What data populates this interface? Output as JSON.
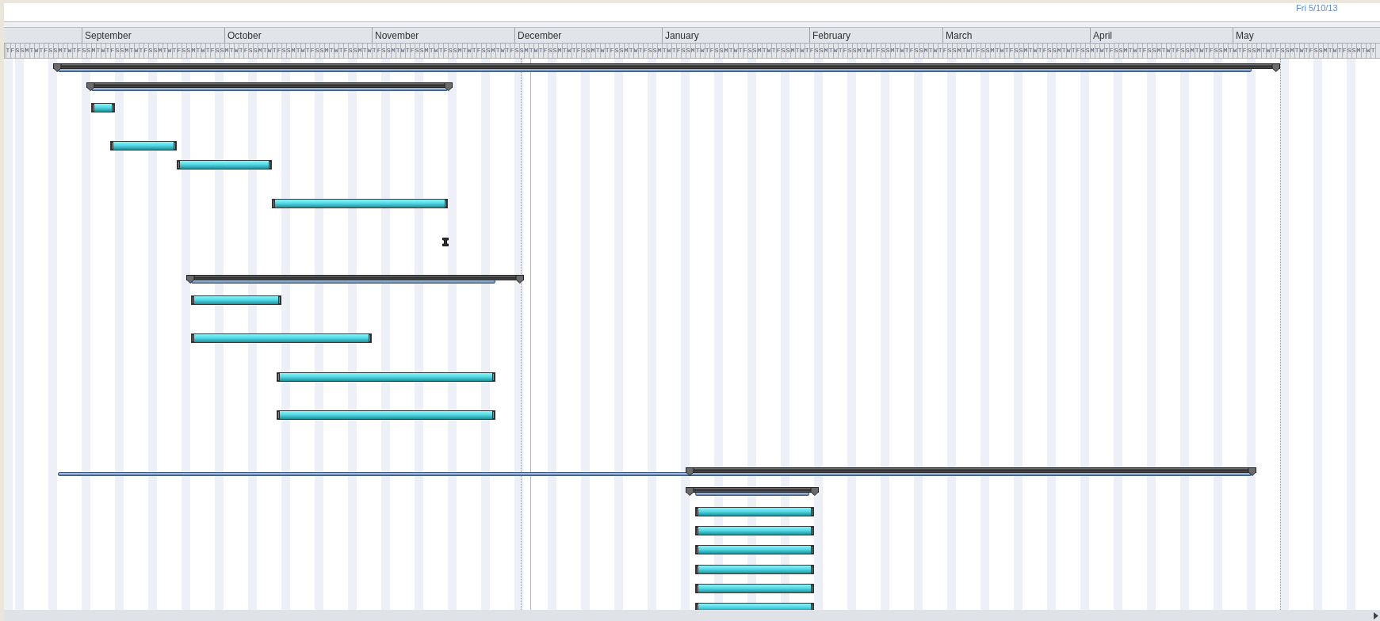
{
  "timescale": {
    "months": [
      "September",
      "October",
      "November",
      "December",
      "January",
      "February",
      "March",
      "April",
      "May"
    ],
    "day_letters": "TFSSMTWTFSSMTWTFSSMTWTFSSMTWTFSSMTWTFSSMTWTFSSMTWTFSSMTWTFSSMTWTFSSMTWTFSSMTWTFSSMTWTFSSMTWTFSSMTWTFSSMTWTFSSMTWTFSSMTWTFSSMTWTFSSMTWTFSSMTWTFSSMTWTFSSMTWTFSSMTWTFSSMTWTFSSMTWTFSSMTWTFSSMTWTFSSMTWTFSSMTWTFSSMTWTFSSMTWTFSSMTWTFSSMTWTFSSMTWTFSSMTWTFSSMTWTFSSMTWTFSSMTWTFSSMTWTFSSMTWTFSSMTWT"
  },
  "markers": [
    {
      "kind": "status"
    },
    {
      "kind": "today"
    },
    {
      "kind": "finish",
      "label": "Fri 5/10/13"
    }
  ],
  "rows": [
    {
      "kind": "summary"
    },
    {
      "kind": "summary"
    },
    {
      "kind": "task"
    },
    {
      "kind": "blank"
    },
    {
      "kind": "task"
    },
    {
      "kind": "task"
    },
    {
      "kind": "blank"
    },
    {
      "kind": "task"
    },
    {
      "kind": "blank"
    },
    {
      "kind": "milestone"
    },
    {
      "kind": "blank"
    },
    {
      "kind": "summary"
    },
    {
      "kind": "task"
    },
    {
      "kind": "blank"
    },
    {
      "kind": "task"
    },
    {
      "kind": "blank"
    },
    {
      "kind": "task"
    },
    {
      "kind": "blank"
    },
    {
      "kind": "task"
    },
    {
      "kind": "blank"
    },
    {
      "kind": "blank"
    },
    {
      "kind": "summary"
    },
    {
      "kind": "summary"
    },
    {
      "kind": "task"
    },
    {
      "kind": "task"
    },
    {
      "kind": "task"
    },
    {
      "kind": "task"
    },
    {
      "kind": "task"
    },
    {
      "kind": "task"
    }
  ]
}
